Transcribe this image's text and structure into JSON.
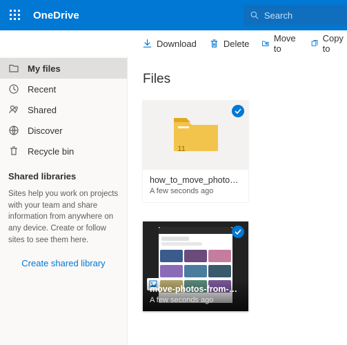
{
  "header": {
    "brand": "OneDrive",
    "search_placeholder": "Search"
  },
  "commands": {
    "download": "Download",
    "delete": "Delete",
    "move_to": "Move to",
    "copy_to": "Copy to"
  },
  "sidebar": {
    "items": [
      {
        "label": "My files"
      },
      {
        "label": "Recent"
      },
      {
        "label": "Shared"
      },
      {
        "label": "Discover"
      },
      {
        "label": "Recycle bin"
      }
    ],
    "shared_libs_title": "Shared libraries",
    "shared_libs_desc": "Sites help you work on projects with your team and share information from anywhere on any device. Create or follow sites to see them here.",
    "create_lib": "Create shared library"
  },
  "content": {
    "title": "Files",
    "items": [
      {
        "name": "how_to_move_photos_f…",
        "time": "A few seconds ago",
        "folder_count": "11"
      },
      {
        "name": "move-photos-from-go…",
        "time": "A few seconds ago"
      }
    ]
  }
}
